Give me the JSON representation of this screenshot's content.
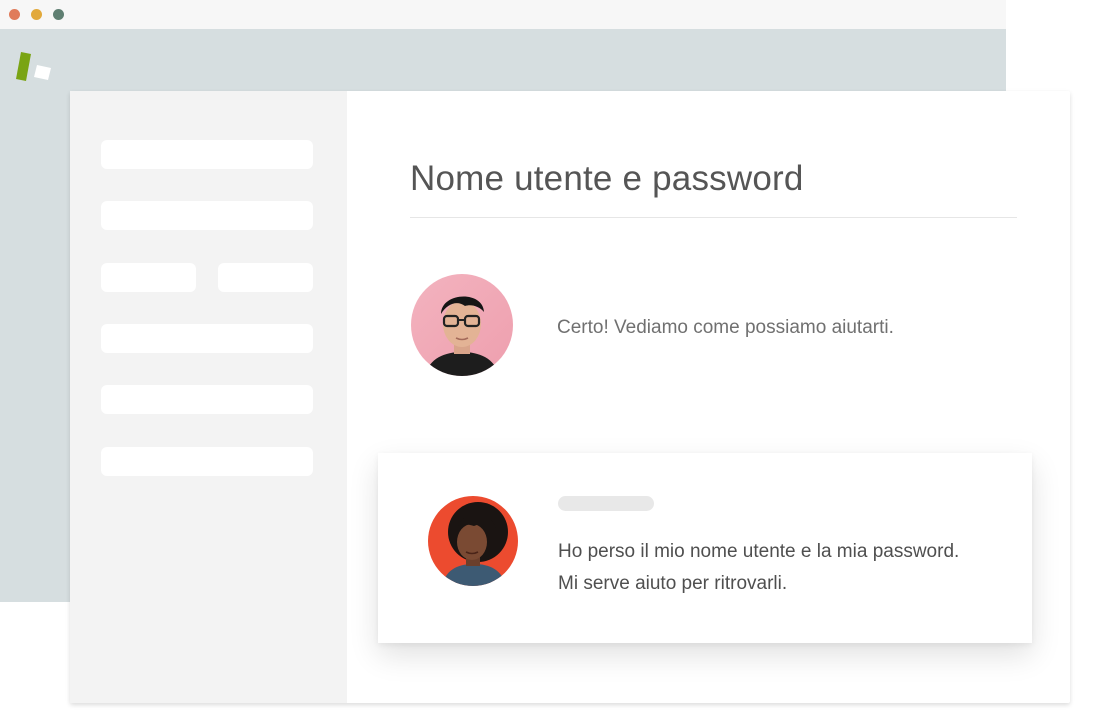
{
  "colors": {
    "dot_red": "#e07b5a",
    "dot_yellow": "#e2a93b",
    "dot_green": "#5f7f72",
    "logo_green": "#7aa414",
    "backdrop": "#d6dee0",
    "sidebar_bg": "#f3f3f3"
  },
  "window_controls": [
    "close-dot",
    "minimize-dot",
    "maximize-dot"
  ],
  "conversation": {
    "title": "Nome utente e password",
    "agent_message": {
      "avatar_icon": "agent-avatar",
      "text": "Certo! Vediamo come possiamo aiutarti."
    },
    "user_message": {
      "avatar_icon": "user-avatar",
      "line1": "Ho perso il mio nome utente e la mia password.",
      "line2": "Mi serve aiuto per ritrovarli."
    }
  }
}
